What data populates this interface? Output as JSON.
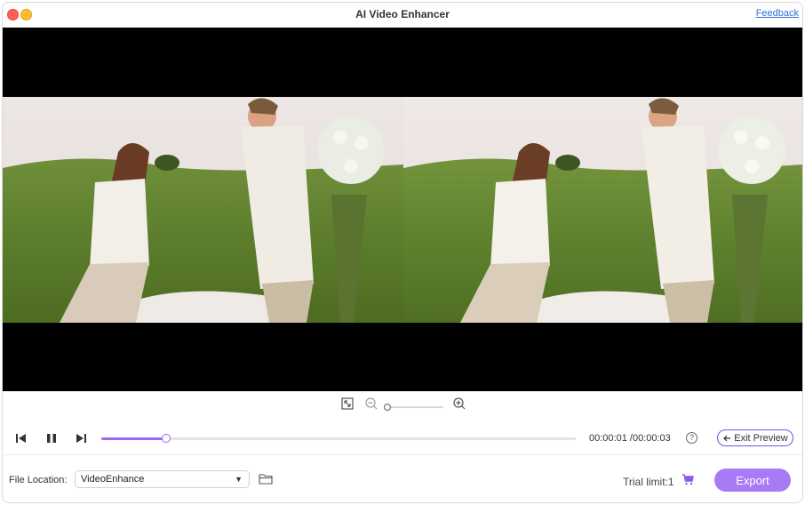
{
  "window": {
    "title": "AI Video Enhancer",
    "feedback_label": "Feedback"
  },
  "preview": {
    "left_label": "",
    "right_label": ""
  },
  "zoom": {
    "icons": [
      "fit-screen-icon",
      "zoom-out-icon",
      "zoom-slider",
      "zoom-in-icon"
    ]
  },
  "playback": {
    "progress": 0.137,
    "current_time": "00:00:01",
    "total_time": "/00:00:03",
    "exit_preview_label": "Exit Preview",
    "help_symbol": "?"
  },
  "footer": {
    "file_location_label": "File Location:",
    "file_location_value": "VideoEnhance",
    "trial_label": "Trial limit:1",
    "export_label": "Export"
  },
  "colors": {
    "accent": "#9b6bf0",
    "export_bg": "#a87af5",
    "feedback_link": "#2f6fd8"
  }
}
